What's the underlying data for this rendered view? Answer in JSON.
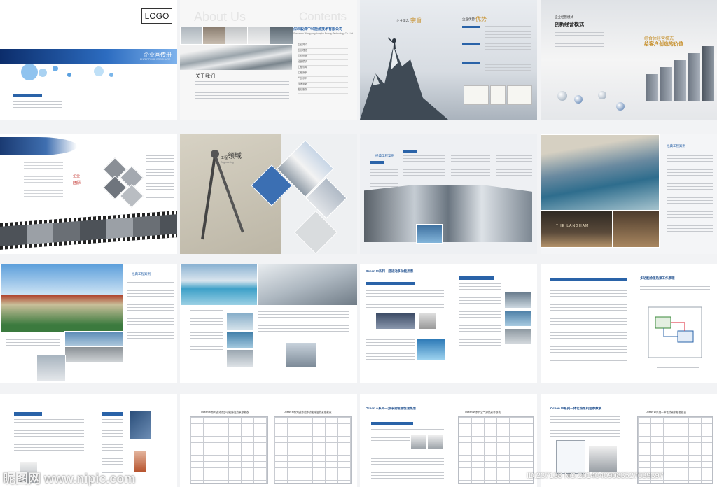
{
  "cover": {
    "logo": "LOGO",
    "title": "企业画传册",
    "subtitle": "ENTERPRISE BROCHURE"
  },
  "about": {
    "heading_en": "About Us",
    "heading_cn": "关于我们"
  },
  "contents": {
    "heading": "Contents",
    "company_cn": "深圳毅洋中科能源技术有限公司",
    "company_en": "Shenzhen Wangyangzhongke Energy Technology Co., Ltd",
    "items": [
      "企业简介",
      "企业理念",
      "企业优势",
      "经营模式",
      "工程领域",
      "工程案例",
      "产品系列",
      "技术参数",
      "售后服务"
    ]
  },
  "philosophy": {
    "title": "企业理念",
    "accent": "宗旨"
  },
  "advantage": {
    "title": "企业优势",
    "accent": "优势"
  },
  "business_model": {
    "label": "企业经营模式",
    "title": "创新经营模式",
    "slogan_1": "综合体经营模式",
    "slogan_2": "给客户创造的价值"
  },
  "team": {
    "title": "团队",
    "label": "企业"
  },
  "field": {
    "title_small": "工程",
    "title_big": "领域",
    "title_en": "Engineering"
  },
  "cases": {
    "title": "经典工程案例"
  },
  "hotel": {
    "sign": "THE LANGHAM"
  },
  "product_a": {
    "title": "Ocean M系列—游泳池多功能热泵",
    "sub": "多功能热泵"
  },
  "principle": {
    "title": "多功能除湿热泵工作原理"
  },
  "product_b": {
    "title": "Ocean A系列—游泳池恒温恒湿热泵"
  },
  "table_1": {
    "title": "Ocean M系列游泳池多功能除湿热泵参数表"
  },
  "table_2": {
    "title": "Ocean W系列空气源热泵参数表"
  },
  "table_3": {
    "title": "Ocean W系列—体化热泵机组参数表"
  },
  "watermark": {
    "site": "昵图网 www.nipic.com",
    "id": "ID:237138 NO:20140409083527039397"
  }
}
